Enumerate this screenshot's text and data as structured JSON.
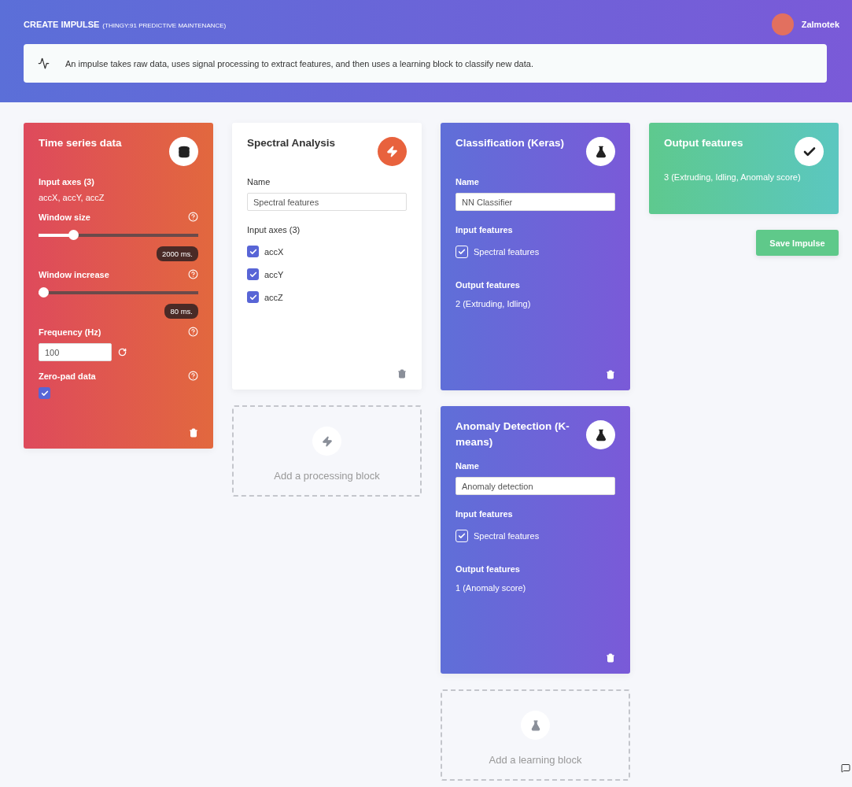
{
  "header": {
    "title": "CREATE IMPULSE",
    "subtitle": "(THINGY:91 PREDICTIVE MAINTENANCE)",
    "user": "Zalmotek"
  },
  "banner": {
    "text": "An impulse takes raw data, uses signal processing to extract features, and then uses a learning block to classify new data."
  },
  "input_block": {
    "title": "Time series data",
    "axes_label": "Input axes (3)",
    "axes": "accX, accY, accZ",
    "sliders": [
      {
        "label": "Window size",
        "level": 0.2,
        "reading": "2000 ms."
      },
      {
        "label": "Window increase",
        "level": 0,
        "reading": "80 ms."
      }
    ],
    "frequency": {
      "label": "Frequency (Hz)",
      "value": "100"
    },
    "zero_pad": {
      "label": "Zero-pad data",
      "checked": true
    }
  },
  "processing_blocks": [
    {
      "title": "Spectral Analysis",
      "name_label": "Name",
      "name": "Spectral features",
      "axes_label": "Input axes (3)",
      "axes": [
        {
          "label": "accX",
          "checked": true
        },
        {
          "label": "accY",
          "checked": true
        },
        {
          "label": "accZ",
          "checked": true
        }
      ]
    }
  ],
  "add_processing": {
    "label": "Add a processing block"
  },
  "learning_blocks": [
    {
      "title": "Classification (Keras)",
      "name_label": "Name",
      "name": "NN Classifier",
      "input_label": "Input features",
      "inputs": [
        {
          "label": "Spectral features",
          "checked": true
        }
      ],
      "output_label": "Output features",
      "output": "2 (Extruding, Idling)"
    },
    {
      "title": "Anomaly Detection (K-means)",
      "name_label": "Name",
      "name": "Anomaly detection",
      "input_label": "Input features",
      "inputs": [
        {
          "label": "Spectral features",
          "checked": true
        }
      ],
      "output_label": "Output features",
      "output": "1 (Anomaly score)"
    }
  ],
  "add_learning": {
    "label": "Add a learning block"
  },
  "output_block": {
    "title": "Output features",
    "text": "3 (Extruding, Idling, Anomaly score)"
  },
  "save_button": "Save Impulse"
}
